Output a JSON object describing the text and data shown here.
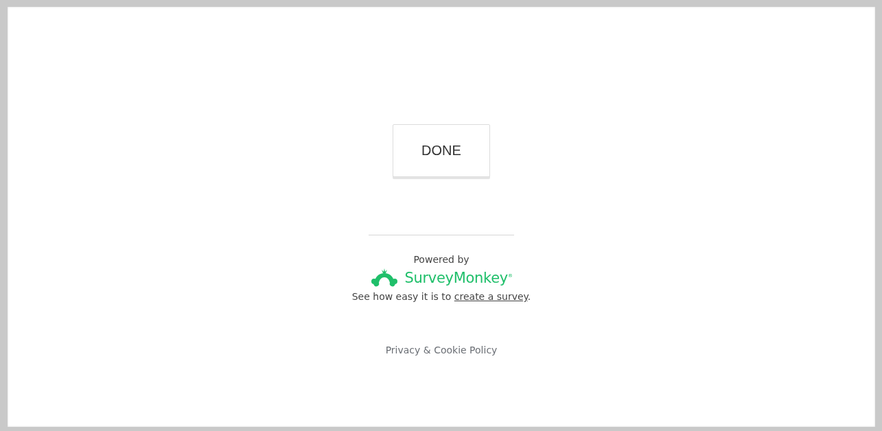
{
  "done_button": {
    "label": "DONE"
  },
  "footer": {
    "powered_by": "Powered by",
    "brand": "SurveyMonkey",
    "brand_mark": "®",
    "promo": {
      "prefix": "See how easy it is to ",
      "link": "create a survey",
      "suffix": "."
    },
    "privacy_link": "Privacy & Cookie Policy"
  }
}
